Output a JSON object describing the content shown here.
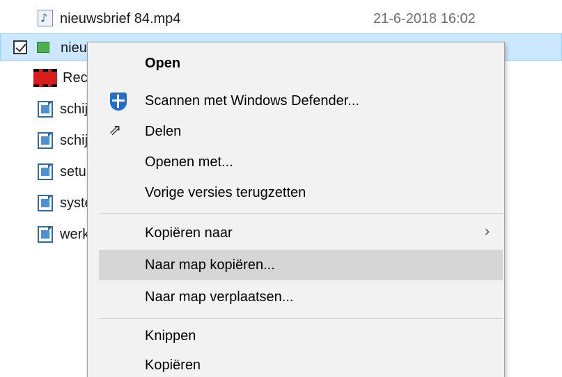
{
  "files": [
    {
      "name": "nieuwsbrief 84.mp4",
      "date": "21-6-2018 16:02",
      "icon": "audio-file-icon"
    },
    {
      "name": "nieu",
      "icon": "video-file-icon"
    },
    {
      "name": "Rec (",
      "icon": "recording-file-icon"
    },
    {
      "name": "schij",
      "icon": "image-file-icon"
    },
    {
      "name": "schij",
      "icon": "image-file-icon"
    },
    {
      "name": "setu",
      "icon": "image-file-icon"
    },
    {
      "name": "syste",
      "icon": "image-file-icon"
    },
    {
      "name": "werk",
      "icon": "image-file-icon"
    }
  ],
  "menu": {
    "open": "Open",
    "scan": "Scannen met Windows Defender...",
    "share": "Delen",
    "open_with": "Openen met...",
    "restore": "Vorige versies terugzetten",
    "copy_to": "Kopiëren naar",
    "copy_to_folder": "Naar map kopiëren...",
    "move_to_folder": "Naar map verplaatsen...",
    "cut": "Knippen",
    "copy": "Kopiëren"
  },
  "colors": {
    "selection": "#cce8ff",
    "menu_background": "#f2f2f2",
    "menu_highlight": "#d6d6d6",
    "defender_blue": "#1f6fd1"
  }
}
